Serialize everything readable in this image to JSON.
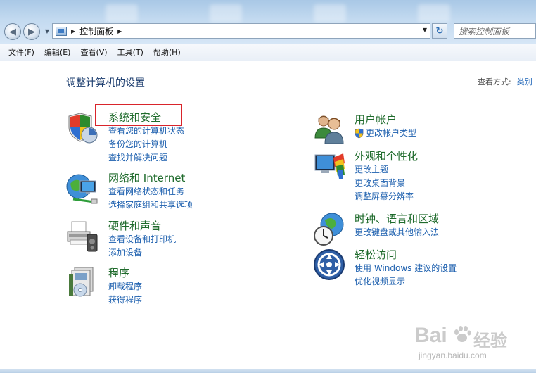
{
  "address": {
    "breadcrumb": "控制面板",
    "search_placeholder": "搜索控制面板"
  },
  "menu": [
    "文件(F)",
    "编辑(E)",
    "查看(V)",
    "工具(T)",
    "帮助(H)"
  ],
  "page": {
    "title": "调整计算机的设置",
    "view_label": "查看方式:",
    "view_value": "类别"
  },
  "left_categories": [
    {
      "title": "系统和安全",
      "icon": "shield-icon",
      "links": [
        "查看您的计算机状态",
        "备份您的计算机",
        "查找并解决问题"
      ]
    },
    {
      "title": "网络和 Internet",
      "icon": "network-globe-icon",
      "links": [
        "查看网络状态和任务",
        "选择家庭组和共享选项"
      ]
    },
    {
      "title": "硬件和声音",
      "icon": "printer-icon",
      "links": [
        "查看设备和打印机",
        "添加设备"
      ]
    },
    {
      "title": "程序",
      "icon": "programs-icon",
      "links": [
        "卸载程序",
        "获得程序"
      ]
    }
  ],
  "right_categories": [
    {
      "title": "用户帐户",
      "icon": "users-icon",
      "links": [
        "更改帐户类型"
      ]
    },
    {
      "title": "外观和个性化",
      "icon": "monitor-palette-icon",
      "links": [
        "更改主题",
        "更改桌面背景",
        "调整屏幕分辨率"
      ]
    },
    {
      "title": "时钟、语言和区域",
      "icon": "clock-globe-icon",
      "links": [
        "更改键盘或其他输入法"
      ]
    },
    {
      "title": "轻松访问",
      "icon": "ease-of-access-icon",
      "links": [
        "使用 Windows 建议的设置",
        "优化视频显示"
      ]
    }
  ],
  "watermark": {
    "brand_left": "Bai",
    "brand_right": "经验",
    "url": "jingyan.baidu.com"
  },
  "colors": {
    "category_title": "#1f6b2c",
    "link": "#1c5fae",
    "page_title": "#1b3c6e",
    "highlight": "#d9242b"
  }
}
